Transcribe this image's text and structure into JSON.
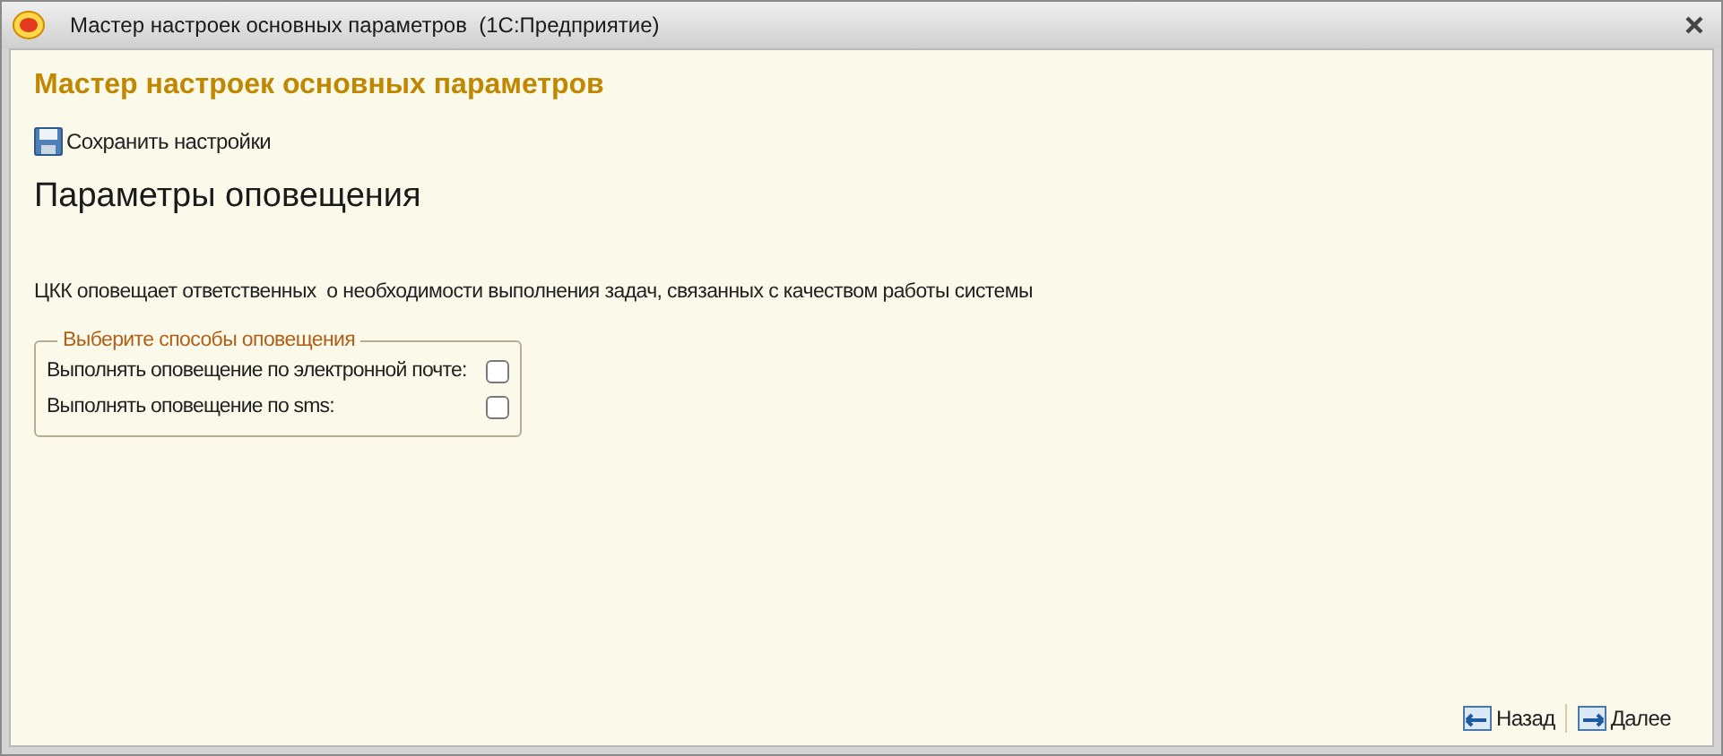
{
  "window": {
    "title": "Мастер настроек основных параметров  (1С:Предприятие)"
  },
  "heading": "Мастер настроек основных параметров",
  "toolbar": {
    "save_button": "Сохранить настройки"
  },
  "section_title": "Параметры оповещения",
  "description": "ЦКК оповещает ответственных  о необходимости выполнения задач, связанных с качеством работы системы",
  "group": {
    "title": "Выберите способы оповещения",
    "options": [
      {
        "label": "Выполнять оповещение по электронной почте:",
        "checked": false
      },
      {
        "label": "Выполнять оповещение по sms:",
        "checked": false
      }
    ]
  },
  "footer": {
    "back_button": "Назад",
    "next_button": "Далее"
  }
}
